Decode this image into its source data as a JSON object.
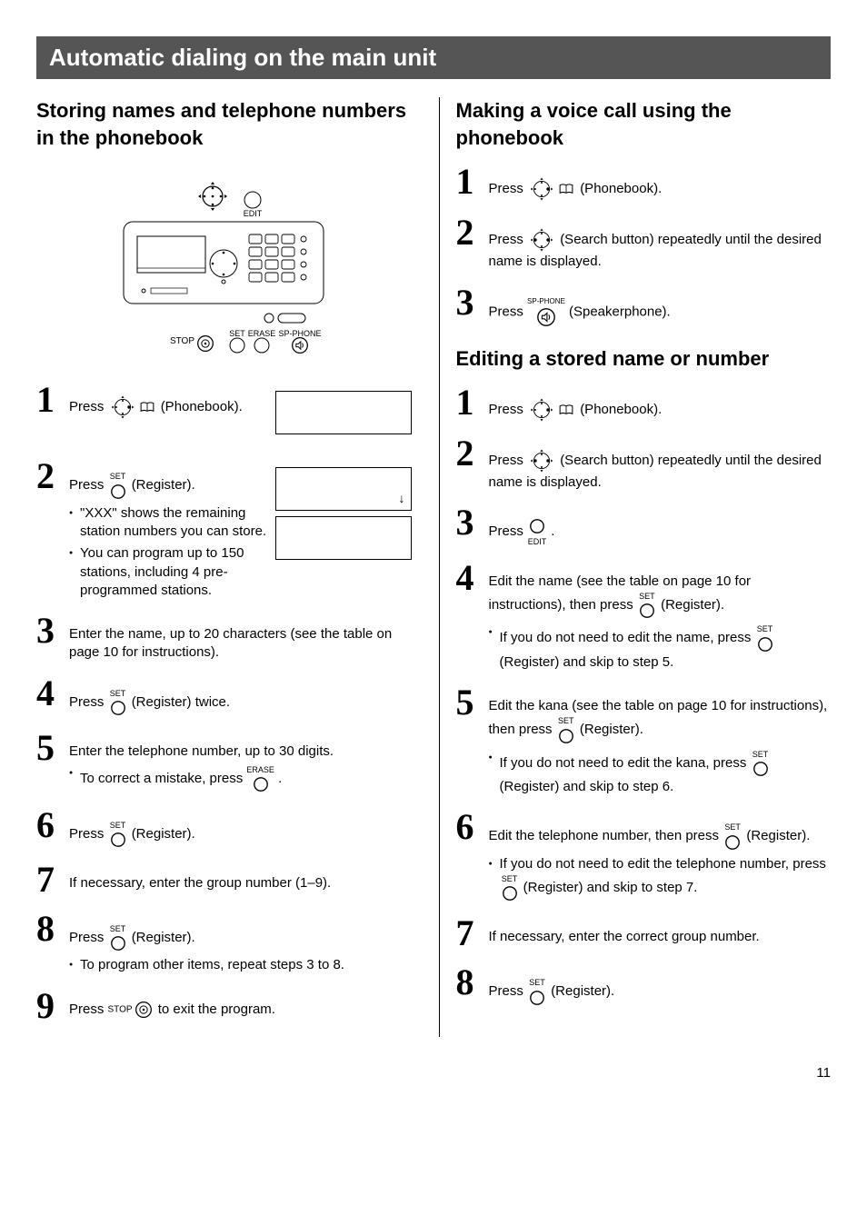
{
  "banner": "Automatic dialing on the main unit",
  "pageNumber": "11",
  "buttons": {
    "phonebook": "(Phonebook)",
    "register": "(Register)",
    "speakerphone": "(Speakerphone)",
    "searchRepeat": "(Search button) repeatedly until the desired name is displayed.",
    "set": "SET",
    "erase": "ERASE",
    "spphone": "SP-PHONE",
    "stop": "STOP",
    "edit": "EDIT"
  },
  "left": {
    "heading": "Storing names and telephone numbers in the phonebook",
    "s1": {
      "press": "Press",
      "after": " (Phonebook)."
    },
    "s2": {
      "press": "Press",
      "after": " (Register).",
      "note1": "\"XXX\" shows the remaining station numbers you can store.",
      "note2": "You can program up to 150 stations, including 4 pre-programmed stations."
    },
    "s3": {
      "text": "Enter the name, up to 20 characters (see the table on page 10 for instructions)."
    },
    "s4": {
      "press": "Press",
      "after": " (Register) twice."
    },
    "s5": {
      "text": "Enter the telephone number, up to 30 digits.",
      "note1a": "To correct a mistake, press ",
      "note1b": " ."
    },
    "s6": {
      "press": "Press",
      "after": " (Register)."
    },
    "s7": {
      "text": "If necessary, enter the group number (1–9)."
    },
    "s8": {
      "press": "Press",
      "after": " (Register).",
      "note1": "To program other items, repeat steps 3 to 8."
    },
    "s9": {
      "pressA": " Press ",
      "pressB": " to exit the program."
    }
  },
  "rightA": {
    "heading": "Making a voice call using the phonebook",
    "s1": {
      "press": "Press",
      "after": " (Phonebook)."
    },
    "s2": {
      "press": "Press",
      "after": " (Search button) repeatedly until the desired name is displayed."
    },
    "s3": {
      "press": "Press",
      "after": " (Speakerphone)."
    }
  },
  "rightB": {
    "heading": "Editing a stored name or number",
    "s1": {
      "press": "Press",
      "after": " (Phonebook)."
    },
    "s2": {
      "press": "Press",
      "after": " (Search button) repeatedly until the desired name is displayed."
    },
    "s3": {
      "press": "Press",
      "after": " ."
    },
    "s4": {
      "textA": "Edit the name (see the table on page 10 for instructions), then press ",
      "textB": " (Register).",
      "note1a": "If you do not need to edit the name, press ",
      "note1b": " (Register) and skip to step 5."
    },
    "s5": {
      "textA": "Edit the kana (see the table on page 10 for instructions), then press ",
      "textB": " (Register).",
      "note1a": "If you do not need to edit the kana, press ",
      "note1b": " (Register) and skip to step 6."
    },
    "s6": {
      "textA": "Edit the telephone number, then press ",
      "textB": " (Register).",
      "note1a": "If you do not need to edit the telephone number, press ",
      "note1b": " (Register) and skip to step 7."
    },
    "s7": {
      "text": "If necessary, enter the correct group number."
    },
    "s8": {
      "press": "Press",
      "after": " (Register)."
    }
  }
}
